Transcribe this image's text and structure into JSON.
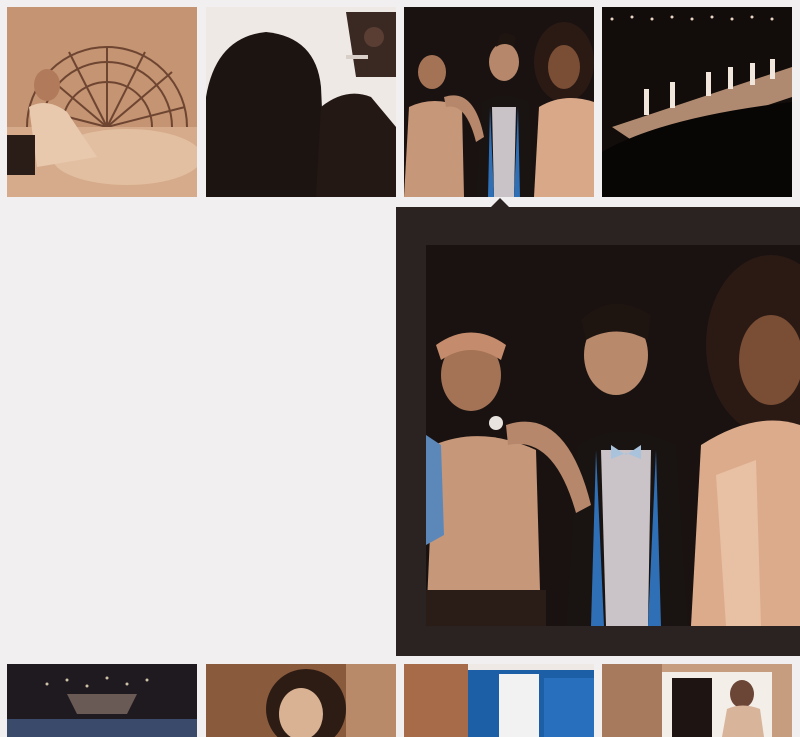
{
  "gallery": {
    "background": "#f2eff1",
    "top_row": [
      {
        "name": "woman-reclining-with-fan",
        "tone": "#c49473"
      },
      {
        "name": "silhouette-with-camera",
        "tone": "#1c1411"
      },
      {
        "name": "three-models-backstage",
        "tone": "#2a1d17",
        "selected": true
      },
      {
        "name": "runway-show",
        "tone": "#120c0a"
      }
    ],
    "bottom_row": [
      {
        "name": "chandelier-venue",
        "tone": "#1f1a20"
      },
      {
        "name": "woman-portrait-sepia",
        "tone": "#8a5a3d"
      },
      {
        "name": "blue-building-facade",
        "tone": "#1d5fa6"
      },
      {
        "name": "woman-at-window",
        "tone": "#c79d7f"
      }
    ]
  },
  "expanded_view": {
    "panel_color": "#2a2321",
    "image": "three-models-backstage"
  }
}
